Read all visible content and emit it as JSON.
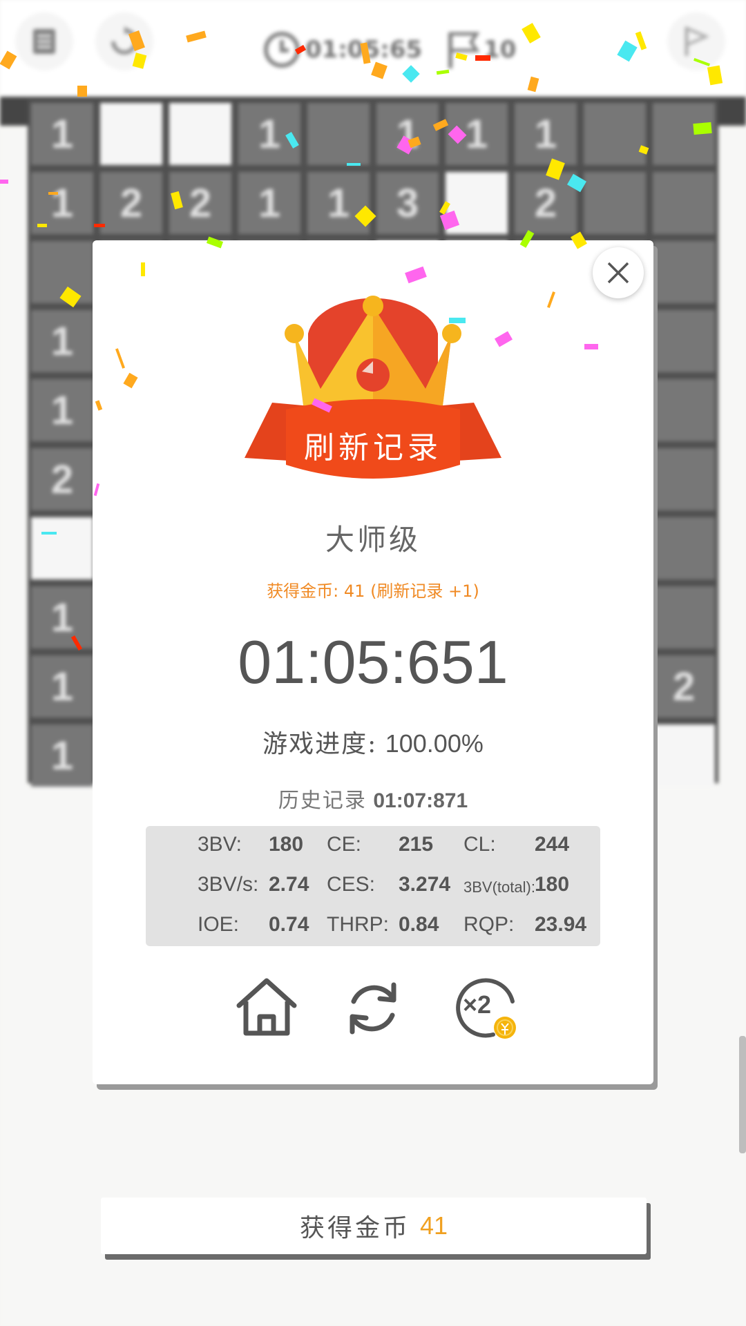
{
  "topbar": {
    "timer": "01:05:65",
    "flags": "10"
  },
  "board": {
    "rows": [
      [
        "1",
        "open",
        "open",
        "1",
        "",
        "1",
        "1",
        "1",
        "",
        ""
      ],
      [
        "1",
        "2",
        "2",
        "1",
        "1",
        "3",
        "open",
        "2",
        "",
        ""
      ],
      [
        "",
        "",
        "",
        "",
        "",
        "open",
        "open",
        "",
        "",
        ""
      ],
      [
        "1",
        "",
        "",
        "",
        "",
        "",
        "",
        "",
        "",
        ""
      ],
      [
        "1",
        "",
        "",
        "",
        "",
        "",
        "",
        "",
        "",
        ""
      ],
      [
        "2",
        "",
        "",
        "",
        "",
        "",
        "",
        "",
        "",
        ""
      ],
      [
        "open",
        "",
        "",
        "",
        "",
        "",
        "",
        "",
        "",
        ""
      ],
      [
        "1",
        "",
        "",
        "",
        "",
        "",
        "",
        "",
        "",
        ""
      ],
      [
        "1",
        "",
        "",
        "",
        "",
        "",
        "",
        "",
        "",
        "2"
      ],
      [
        "1",
        "",
        "",
        "",
        "",
        "",
        "",
        "",
        "",
        "open"
      ]
    ]
  },
  "dialog": {
    "banner": "刷新记录",
    "level": "大师级",
    "coins_line": "获得金币: 41 (刷新记录 +1)",
    "time": "01:05:651",
    "progress_label": "游戏进度:",
    "progress_value": "100.00%",
    "history_label": "历史记录",
    "history_value": "01:07:871",
    "stats": [
      {
        "k1": "3BV:",
        "v1": "180",
        "k2": "CE:",
        "v2": "215",
        "k3": "CL:",
        "v3": "244"
      },
      {
        "k1": "3BV/s:",
        "v1": "2.74",
        "k2": "CES:",
        "v2": "3.274",
        "k3": "3BV(total):",
        "v3": "180"
      },
      {
        "k1": "IOE:",
        "v1": "0.74",
        "k2": "THRP:",
        "v2": "0.84",
        "k3": "RQP:",
        "v3": "23.94"
      }
    ],
    "double_badge": "×2"
  },
  "coin_bar": {
    "label": "获得金币",
    "value": "41"
  },
  "colors": {
    "accent_orange": "#f08a24",
    "coin_gold": "#f0a020",
    "banner_red": "#e84a1c",
    "crown_yellow": "#f9c22e"
  },
  "icons": [
    "menu-icon",
    "restart-icon",
    "clock-icon",
    "flag-icon",
    "close-icon",
    "home-icon",
    "replay-icon",
    "double-coins-icon"
  ]
}
